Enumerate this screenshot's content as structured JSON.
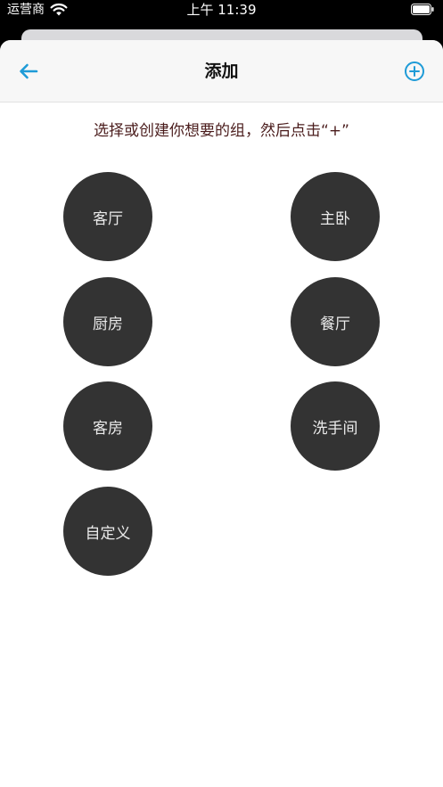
{
  "status_bar": {
    "carrier": "运营商",
    "time": "上午 11:39"
  },
  "nav": {
    "title": "添加"
  },
  "instruction": "选择或创建你想要的组，然后点击“+”",
  "groups": [
    "客厅",
    "主卧",
    "厨房",
    "餐厅",
    "客房",
    "洗手间",
    "自定义"
  ],
  "colors": {
    "accent": "#1e9bd7",
    "circle": "#333333",
    "instruction_text": "#4a1c1c"
  },
  "icons": {
    "back": "arrow-left-icon",
    "add": "plus-circle-icon",
    "wifi": "wifi-icon",
    "battery": "battery-icon"
  }
}
